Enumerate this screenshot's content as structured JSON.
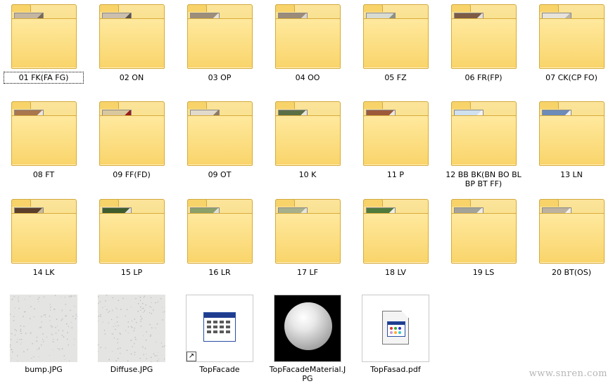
{
  "folders": [
    {
      "name": "01 FK(FA FG)",
      "photo": [
        "#c4b6a0",
        "#7a6a55"
      ],
      "selected": true
    },
    {
      "name": "02 ON",
      "photo": [
        "#cbbfad",
        "#5b5248"
      ]
    },
    {
      "name": "03 OP",
      "photo": [
        "#9d8e7a",
        "#e8e2d8"
      ]
    },
    {
      "name": "04 OO",
      "photo": [
        "#9b8b79",
        "#dcd6cf"
      ]
    },
    {
      "name": "05 FZ",
      "photo": [
        "#d8dbd2",
        "#8c9186"
      ]
    },
    {
      "name": "06 FR(FP)",
      "photo": [
        "#7d5b45",
        "#e6e1da"
      ]
    },
    {
      "name": "07 CK(CP FO)",
      "photo": [
        "#e7e3da",
        "#b9b4ab"
      ]
    },
    {
      "name": "08 FT",
      "photo": [
        "#a9764e",
        "#ece6de"
      ]
    },
    {
      "name": "09 FF(FD)",
      "photo": [
        "#d9c79d",
        "#9a1c1c"
      ]
    },
    {
      "name": "09 OT",
      "photo": [
        "#e1d9cb",
        "#8d7a66"
      ]
    },
    {
      "name": "10 K",
      "photo": [
        "#5b6f45",
        "#e8e5dd"
      ]
    },
    {
      "name": "11 P",
      "photo": [
        "#9d5a3b",
        "#ece7df"
      ]
    },
    {
      "name": "12 BB BK(BN BO BL BP BT FF)",
      "photo": [
        "#cfe0ef",
        "#f3f3f3"
      ]
    },
    {
      "name": "13 LN",
      "photo": [
        "#6c8bb8",
        "#f0f0f0"
      ]
    },
    {
      "name": "14 LK",
      "photo": [
        "#5b3f2b",
        "#c9b896"
      ]
    },
    {
      "name": "15 LP",
      "photo": [
        "#3f5c2e",
        "#e6e1d9"
      ]
    },
    {
      "name": "16 LR",
      "photo": [
        "#8ca06a",
        "#dfe0da"
      ]
    },
    {
      "name": "17 LF",
      "photo": [
        "#a7b08c",
        "#e8e6de"
      ]
    },
    {
      "name": "18 LV",
      "photo": [
        "#4f7a3c",
        "#f1eee8"
      ]
    },
    {
      "name": "19 LS",
      "photo": [
        "#a3a39a",
        "#efece6"
      ]
    },
    {
      "name": "20 BT(OS)",
      "photo": [
        "#bcb29f",
        "#f3f0ea"
      ]
    }
  ],
  "files": [
    {
      "name": "bump.JPG",
      "kind": "texture"
    },
    {
      "name": "Diffuse.JPG",
      "kind": "texture"
    },
    {
      "name": "TopFacade",
      "kind": "shortcut",
      "icon": "application-window-icon"
    },
    {
      "name": "TopFacadeMaterial.JPG",
      "kind": "sphere"
    },
    {
      "name": "TopFasad.pdf",
      "kind": "pdf",
      "icon": "pdf-document-icon"
    }
  ],
  "watermark": "www.snren.com",
  "colors": {
    "folder": "#f9d46a",
    "accent": "#1f3d8f"
  }
}
